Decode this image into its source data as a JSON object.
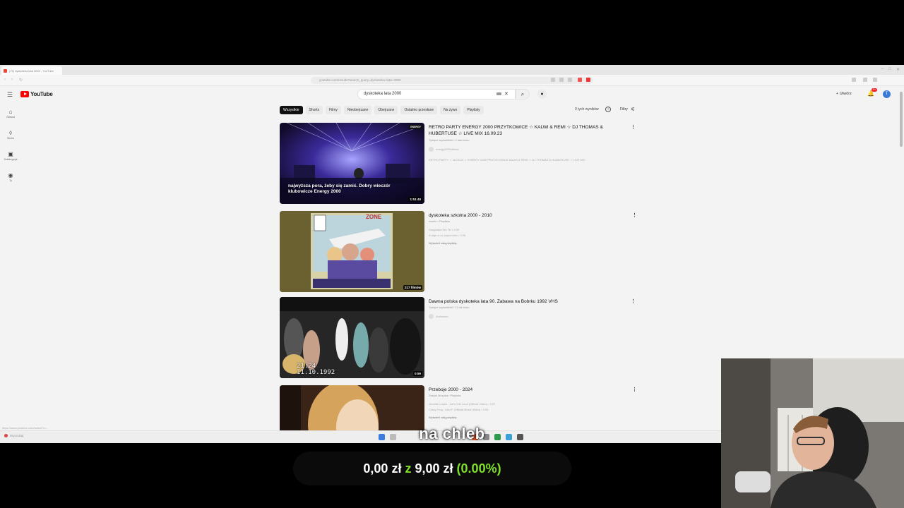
{
  "browser": {
    "tab_title": "(75) dyskoteka lata 2000 - YouTube",
    "url": "youtube.com/results?search_query=dyskoteka+lata+2000"
  },
  "youtube": {
    "logo_text": "YouTube",
    "search_value": "dyskoteka lata 2000",
    "create_label": "Utwórz",
    "notifications_badge": "9+",
    "avatar_letter": "T",
    "sidebar": [
      {
        "icon": "home-icon",
        "label": "Główna"
      },
      {
        "icon": "shorts-icon",
        "label": "Shorts"
      },
      {
        "icon": "subscriptions-icon",
        "label": "Subskrypcje"
      },
      {
        "icon": "you-icon",
        "label": "Ty"
      }
    ],
    "chips": [
      "Wszystkie",
      "Shorts",
      "Filmy",
      "Nieobejrzane",
      "Obejrzane",
      "Ostatnio przesłane",
      "Na żywo",
      "Playlisty"
    ],
    "result_count": "0 tych wyników",
    "filters_label": "Filtry",
    "results": [
      {
        "title": "RETRO PARTY ENERGY 2000 PRZYTKOWICE ☆ KALWI & REMI ☆ DJ THOMAS & HUBERTUSE ☆ LIVE MIX 16.09.23",
        "meta": "Tysiące wyświetleń • 2 lata temu",
        "channel": "energy2000official",
        "description": "RETRO PARTY ☆ 16.09.23 ☆ ENERGY 2000 PRZYTKOWICE KALWI & REMI ☆ DJ THOMAS & HUBERTUSE ☆ LIVE MIX",
        "thumb_overlay": "najwyższa pora, żeby się zamić. Dobry wieczór klubowicze Energy 2000",
        "duration": "1:51:40",
        "corner_badge": "ENERGY"
      },
      {
        "title": "dyskoteka szkolna 2000 - 2010",
        "meta": "ewelin • Playlista",
        "line1": "Dragostea Din Tei • 3:35",
        "line2": "A daje ci co zapomnieć • 3:26",
        "link": "Wyświetl całą playlistę",
        "duration": "217 filmów",
        "thumb_text": "ZONE"
      },
      {
        "title": "Dawna polska dyskoteka lata 90. Zabawa na Bobrku 1992 VHS",
        "meta": "Tysiące wyświetleń • 13 lat temu",
        "channel": "Archiwum",
        "duration": "0:59",
        "timestamp_line1": "21:24",
        "timestamp_line2": "11.10.1992"
      },
      {
        "title": "Przeboje 2000 - 2024",
        "meta": "Zespół Muzyka • Playlista",
        "line1": "Jennifer Lopez - Let's Get Loud (Official Video) • 3:57",
        "line2": "Crazy Frog - Axel F (Official Music Video) • 2:51",
        "link": "Wyświetl całą playlistę"
      }
    ],
    "status_url": "https://www.youtube.com/watch?v=..."
  },
  "taskbar": {
    "left_label": "Wyszukaj"
  },
  "overlay": {
    "caption": "na chleb",
    "donation_current": "0,00 zł",
    "donation_z": "z",
    "donation_goal": "9,00 zł",
    "donation_pct": "(0.00%)"
  },
  "colors": {
    "youtube_red": "#ff0000",
    "donation_green": "#7fe02a"
  }
}
